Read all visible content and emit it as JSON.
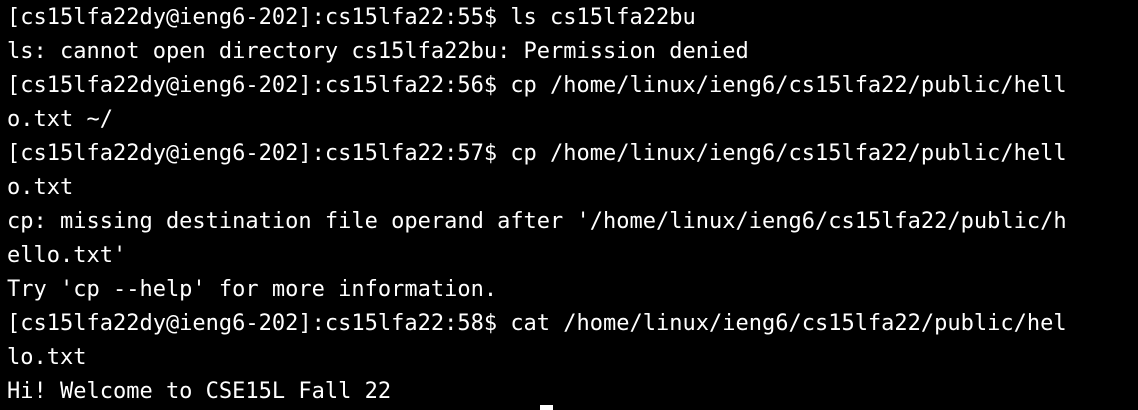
{
  "terminal": {
    "lines": [
      "[cs15lfa22dy@ieng6-202]:cs15lfa22:55$ ls cs15lfa22bu",
      "ls: cannot open directory cs15lfa22bu: Permission denied",
      "[cs15lfa22dy@ieng6-202]:cs15lfa22:56$ cp /home/linux/ieng6/cs15lfa22/public/hell",
      "o.txt ~/",
      "[cs15lfa22dy@ieng6-202]:cs15lfa22:57$ cp /home/linux/ieng6/cs15lfa22/public/hell",
      "o.txt",
      "cp: missing destination file operand after '/home/linux/ieng6/cs15lfa22/public/h",
      "ello.txt'",
      "Try 'cp --help' for more information.",
      "[cs15lfa22dy@ieng6-202]:cs15lfa22:58$ cat /home/linux/ieng6/cs15lfa22/public/hel",
      "lo.txt",
      "Hi! Welcome to CSE15L Fall 22"
    ],
    "background_color": "#000000",
    "text_color": "#ffffff"
  }
}
